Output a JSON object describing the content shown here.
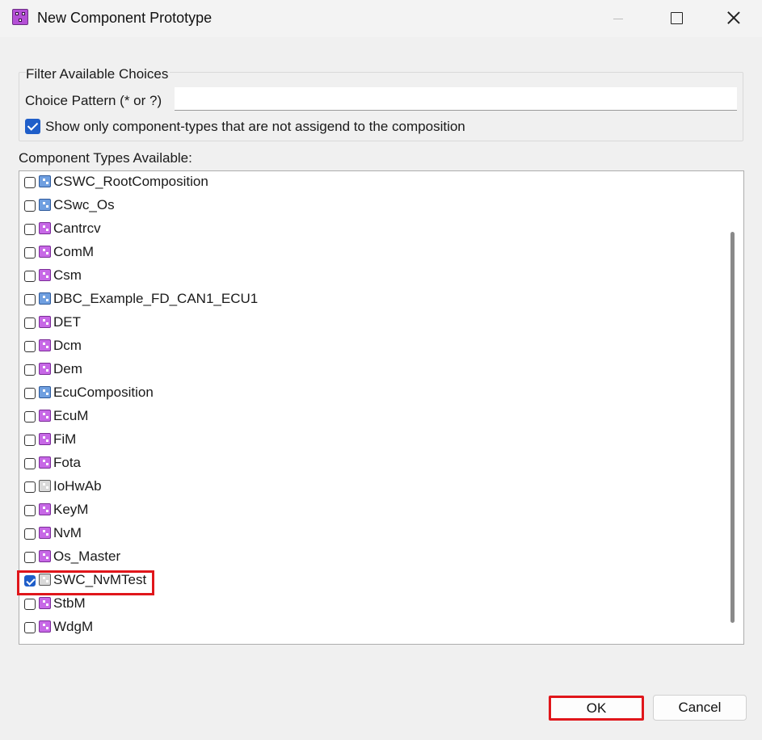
{
  "window": {
    "title": "New Component Prototype",
    "icon": "component-prototype-icon",
    "controls": {
      "minimize": "minimize-icon",
      "maximize": "maximize-icon",
      "close": "close-icon"
    }
  },
  "filter": {
    "group_label": "Filter Available Choices",
    "pattern_label": "Choice Pattern (* or ?)",
    "pattern_value": "",
    "show_only_label": "Show only component-types that are not assigend to the composition",
    "show_only_checked": true
  },
  "types": {
    "label": "Component Types Available:",
    "items": [
      {
        "name": "CSWC_RootComposition",
        "icon": "composition-icon",
        "checked": false
      },
      {
        "name": "CSwc_Os",
        "icon": "composition-icon",
        "checked": false
      },
      {
        "name": "Cantrcv",
        "icon": "application-swc-icon",
        "checked": false
      },
      {
        "name": "ComM",
        "icon": "application-swc-icon",
        "checked": false
      },
      {
        "name": "Csm",
        "icon": "application-swc-icon",
        "checked": false
      },
      {
        "name": "DBC_Example_FD_CAN1_ECU1",
        "icon": "composition-icon",
        "checked": false
      },
      {
        "name": "DET",
        "icon": "application-swc-icon",
        "checked": false
      },
      {
        "name": "Dcm",
        "icon": "application-swc-icon",
        "checked": false
      },
      {
        "name": "Dem",
        "icon": "application-swc-icon",
        "checked": false
      },
      {
        "name": "EcuComposition",
        "icon": "composition-icon",
        "checked": false
      },
      {
        "name": "EcuM",
        "icon": "application-swc-icon",
        "checked": false
      },
      {
        "name": "FiM",
        "icon": "application-swc-icon",
        "checked": false
      },
      {
        "name": "Fota",
        "icon": "application-swc-icon",
        "checked": false
      },
      {
        "name": "IoHwAb",
        "icon": "ecu-abstraction-swc-icon",
        "checked": false
      },
      {
        "name": "KeyM",
        "icon": "application-swc-icon",
        "checked": false
      },
      {
        "name": "NvM",
        "icon": "application-swc-icon",
        "checked": false
      },
      {
        "name": "Os_Master",
        "icon": "application-swc-icon",
        "checked": false
      },
      {
        "name": "SWC_NvMTest",
        "icon": "complex-driver-swc-icon",
        "checked": true,
        "highlighted": true
      },
      {
        "name": "StbM",
        "icon": "application-swc-icon",
        "checked": false
      },
      {
        "name": "WdgM",
        "icon": "application-swc-icon",
        "checked": false
      }
    ]
  },
  "buttons": {
    "ok": "OK",
    "cancel": "Cancel"
  },
  "colors": {
    "highlight": "#e0161b",
    "checkbox_accent": "#1f5ec9"
  }
}
